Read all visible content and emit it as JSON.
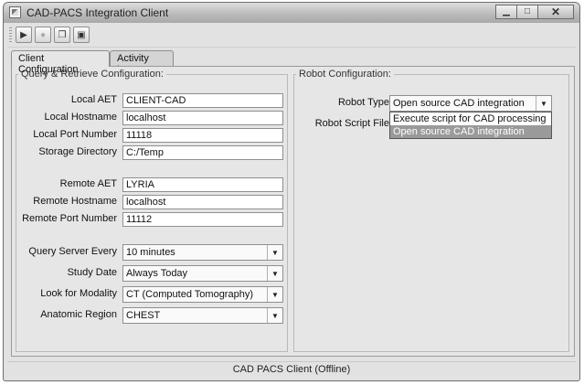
{
  "window": {
    "title": "CAD-PACS Integration Client",
    "minimize_icon": "minimize-icon",
    "maximize_icon": "maximize-icon",
    "close_icon": "close-icon"
  },
  "toolbar": {
    "buttons": [
      {
        "icon": "play-icon"
      },
      {
        "icon": "stop-icon"
      },
      {
        "icon": "copy-icon"
      },
      {
        "icon": "save-icon"
      }
    ]
  },
  "tabs": [
    "Client Configuration",
    "Activity Log"
  ],
  "query_panel": {
    "title": "Query & Retrieve Configuration:",
    "local_aet": {
      "label": "Local AET",
      "value": "CLIENT-CAD"
    },
    "local_hostname": {
      "label": "Local Hostname",
      "value": "localhost"
    },
    "local_port": {
      "label": "Local Port Number",
      "value": "11118"
    },
    "storage_dir": {
      "label": "Storage Directory",
      "value": "C:/Temp"
    },
    "remote_aet": {
      "label": "Remote AET",
      "value": "LYRIA"
    },
    "remote_hostname": {
      "label": "Remote Hostname",
      "value": "localhost"
    },
    "remote_port": {
      "label": "Remote Port Number",
      "value": "11112"
    },
    "query_every": {
      "label": "Query Server Every",
      "value": "10 minutes"
    },
    "study_date": {
      "label": "Study Date",
      "value": "Always Today"
    },
    "modality": {
      "label": "Look for Modality",
      "value": "CT (Computed Tomography)"
    },
    "region": {
      "label": "Anatomic Region",
      "value": "CHEST"
    }
  },
  "robot_panel": {
    "title": "Robot Configuration:",
    "robot_type": {
      "label": "Robot Type",
      "value": "Open source CAD integration"
    },
    "robot_script_label": "Robot Script File",
    "dropdown_options": [
      "Execute script for CAD processing",
      "Open source CAD integration"
    ]
  },
  "status": "CAD PACS Client (Offline)"
}
